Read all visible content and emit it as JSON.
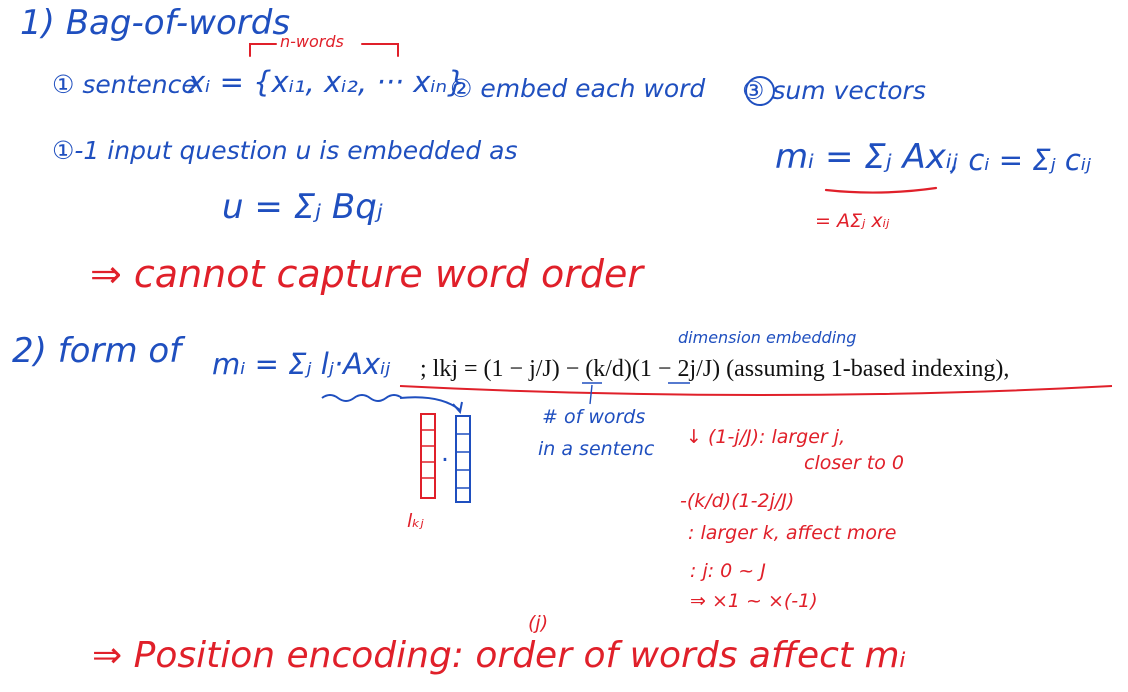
{
  "section1": {
    "heading": "1) Bag-of-words",
    "n_words_label": "n-words",
    "step1": "① sentence",
    "step1_formula": "xᵢ = {xᵢ₁, xᵢ₂, ··· xᵢₙ}",
    "step2": "② embed each word",
    "step3": "③ sum vectors",
    "step1_1": "①-1 input question u is embedded as",
    "u_formula": "u = Σⱼ Bqⱼ",
    "m_formula": "mᵢ = Σⱼ Axᵢⱼ",
    "c_formula": ", cᵢ = Σⱼ cᵢⱼ",
    "m_equiv": "= AΣⱼ xᵢⱼ",
    "conclusion": "⇒ cannot capture word order"
  },
  "section2": {
    "heading": "2) form of",
    "m_formula": "mᵢ = Σⱼ lⱼ·Axᵢⱼ",
    "dimension_note": "dimension embedding",
    "printed_formula": "; lkj = (1 − j/J) − (k/d)(1 − 2j/J) (assuming 1-based indexing),",
    "words_note_1": "# of words",
    "words_note_2": "in a sentenc",
    "vec_dot": "·",
    "lkj_label": "lₖⱼ",
    "note_a1": "↓ (1-j/J): larger j,",
    "note_a2": "closer to 0",
    "note_b1": "-(k/d)(1-2j/J)",
    "note_b2": ": larger k, affect more",
    "note_c1": ": j: 0 ~ J",
    "note_c2": "⇒ ×1 ~ ×(-1)",
    "j_mark": "(j)",
    "final": "⇒ Position encoding: order of words affect mᵢ"
  },
  "colors": {
    "blue_ink": "#1f4fbf",
    "red_ink": "#e0202a",
    "print": "#111111"
  }
}
